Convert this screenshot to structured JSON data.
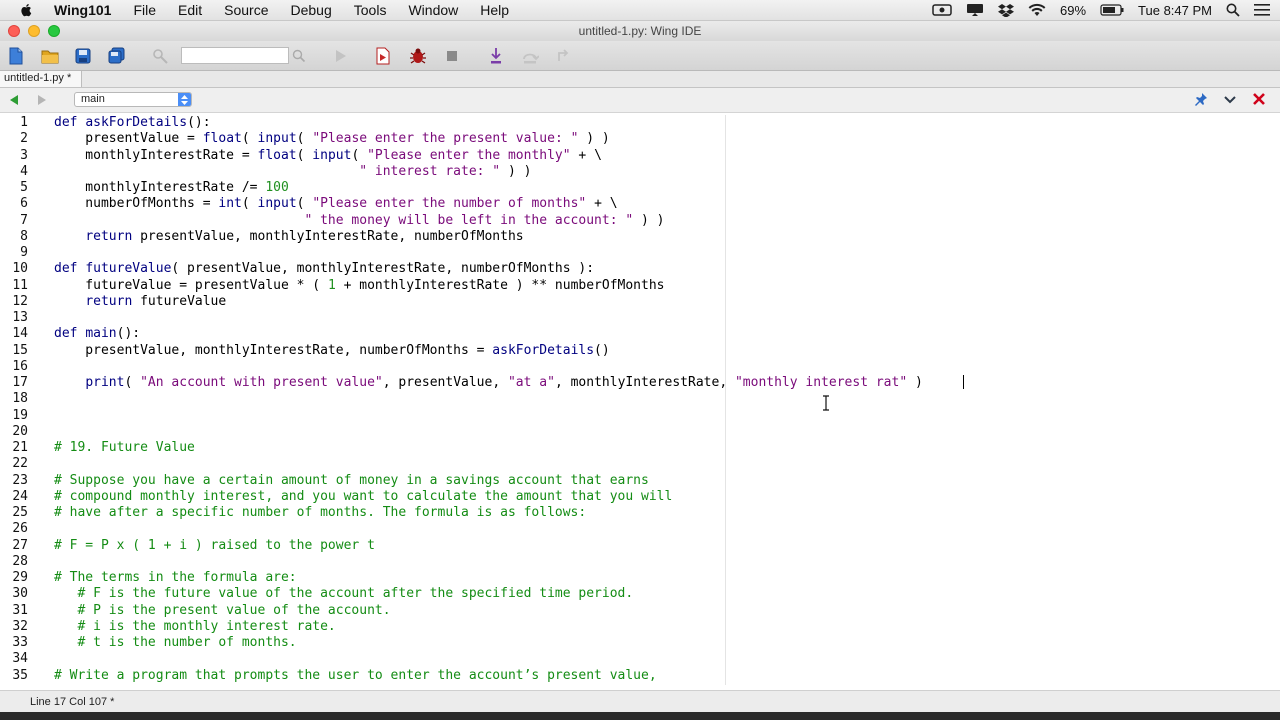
{
  "menubar": {
    "app_name": "Wing101",
    "items": [
      "File",
      "Edit",
      "Source",
      "Debug",
      "Tools",
      "Window",
      "Help"
    ],
    "battery": "69%",
    "clock": "Tue 8:47 PM"
  },
  "window": {
    "title": "untitled-1.py: Wing IDE"
  },
  "tabs": [
    {
      "label": "untitled-1.py *",
      "active": true
    }
  ],
  "navbar": {
    "scope": "main"
  },
  "editor": {
    "lines": [
      {
        "n": "1",
        "text": "def askForDetails():"
      },
      {
        "n": "2",
        "text": "    presentValue = float( input( \"Please enter the present value: \" ) )"
      },
      {
        "n": "3",
        "text": "    monthlyInterestRate = float( input( \"Please enter the monthly\" + \\"
      },
      {
        "n": "4",
        "text": "                                       \" interest rate: \" ) )"
      },
      {
        "n": "5",
        "text": "    monthlyInterestRate /= 100"
      },
      {
        "n": "6",
        "text": "    numberOfMonths = int( input( \"Please enter the number of months\" + \\"
      },
      {
        "n": "7",
        "text": "                                \" the money will be left in the account: \" ) )"
      },
      {
        "n": "8",
        "text": "    return presentValue, monthlyInterestRate, numberOfMonths"
      },
      {
        "n": "9",
        "text": ""
      },
      {
        "n": "10",
        "text": "def futureValue( presentValue, monthlyInterestRate, numberOfMonths ):"
      },
      {
        "n": "11",
        "text": "    futureValue = presentValue * ( 1 + monthlyInterestRate ) ** numberOfMonths"
      },
      {
        "n": "12",
        "text": "    return futureValue"
      },
      {
        "n": "13",
        "text": ""
      },
      {
        "n": "14",
        "text": "def main():"
      },
      {
        "n": "15",
        "text": "    presentValue, monthlyInterestRate, numberOfMonths = askForDetails()"
      },
      {
        "n": "16",
        "text": ""
      },
      {
        "n": "17",
        "text": "    print( \"An account with present value\", presentValue, \"at a\", monthlyInterestRate, \"monthly interest rat\" )"
      },
      {
        "n": "18",
        "text": ""
      },
      {
        "n": "19",
        "text": ""
      },
      {
        "n": "20",
        "text": ""
      },
      {
        "n": "21",
        "text": "# 19. Future Value"
      },
      {
        "n": "22",
        "text": ""
      },
      {
        "n": "23",
        "text": "# Suppose you have a certain amount of money in a savings account that earns"
      },
      {
        "n": "24",
        "text": "# compound monthly interest, and you want to calculate the amount that you will"
      },
      {
        "n": "25",
        "text": "# have after a specific number of months. The formula is as follows:"
      },
      {
        "n": "26",
        "text": ""
      },
      {
        "n": "27",
        "text": "# F = P x ( 1 + i ) raised to the power t"
      },
      {
        "n": "28",
        "text": ""
      },
      {
        "n": "29",
        "text": "# The terms in the formula are:"
      },
      {
        "n": "30",
        "text": "   # F is the future value of the account after the specified time period."
      },
      {
        "n": "31",
        "text": "   # P is the present value of the account."
      },
      {
        "n": "32",
        "text": "   # i is the monthly interest rate."
      },
      {
        "n": "33",
        "text": "   # t is the number of months."
      },
      {
        "n": "34",
        "text": ""
      },
      {
        "n": "35",
        "text": "# Write a program that prompts the user to enter the account’s present value,"
      }
    ]
  },
  "statusbar": {
    "position": "Line 17 Col 107 *"
  },
  "colors": {
    "keyword": "#000080",
    "string": "#7a0a7a",
    "number": "#209020",
    "comment": "#148c14",
    "close_red": "#d0021b",
    "select_blue": "#4a8ef7"
  }
}
